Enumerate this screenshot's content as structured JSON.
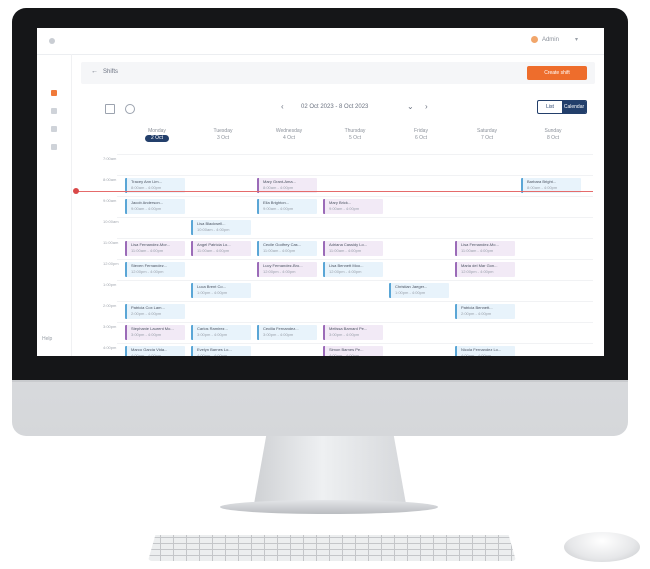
{
  "app": {
    "header_title": "Shifts",
    "create_button": "Create shift",
    "user_name": "Admin",
    "date_range": "02 Oct 2023 - 8 Oct 2023",
    "view_toggle": [
      "List",
      "Calendar"
    ],
    "sidebar_label": "Help"
  },
  "days": [
    {
      "name": "Monday",
      "date": "2 Oct"
    },
    {
      "name": "Tuesday",
      "date": "3 Oct"
    },
    {
      "name": "Wednesday",
      "date": "4 Oct"
    },
    {
      "name": "Thursday",
      "date": "5 Oct"
    },
    {
      "name": "Friday",
      "date": "6 Oct"
    },
    {
      "name": "Saturday",
      "date": "7 Oct"
    },
    {
      "name": "Sunday",
      "date": "8 Oct"
    }
  ],
  "times": [
    "7:00am",
    "8:00am",
    "9:00am",
    "10:00am",
    "11:00am",
    "12:00pm",
    "1:00pm",
    "2:00pm",
    "3:00pm",
    "4:00pm"
  ],
  "events": [
    {
      "title": "Tracey Ann Lim...",
      "sub": "8:00am - 4:00pm",
      "color": "blue"
    },
    {
      "title": "Mary Grant-Ama...",
      "sub": "8:00am - 4:00pm",
      "color": "purple"
    },
    {
      "title": "Barbara Bright...",
      "sub": "8:00am - 4:00pm",
      "color": "blue"
    },
    {
      "title": "Jacob Anderson...",
      "sub": "9:00am - 4:00pm",
      "color": "blue"
    },
    {
      "title": "Ella Brighton...",
      "sub": "9:00am - 4:00pm",
      "color": "blue"
    },
    {
      "title": "Mary Brick...",
      "sub": "9:00am - 4:00pm",
      "color": "purple"
    },
    {
      "title": "Lisa Blackwell...",
      "sub": "10:00am - 4:00pm",
      "color": "blue"
    },
    {
      "title": "Lisa Fernandez-Mor...",
      "sub": "11:00am - 4:00pm",
      "color": "purple"
    },
    {
      "title": "Angel Patricia Lo...",
      "sub": "11:00am - 4:00pm",
      "color": "purple"
    },
    {
      "title": "Cecile Godfrey Cas...",
      "sub": "11:00am - 4:00pm",
      "color": "blue"
    },
    {
      "title": "Adriana Cassidy Lo...",
      "sub": "11:00am - 4:00pm",
      "color": "purple"
    },
    {
      "title": "Lisa Fernandez-Mo...",
      "sub": "11:00am - 4:00pm",
      "color": "purple"
    },
    {
      "title": "Steven Fernandez...",
      "sub": "12:00pm - 4:00pm",
      "color": "blue"
    },
    {
      "title": "Lucy Fernandez-Bro...",
      "sub": "12:00pm - 4:00pm",
      "color": "purple"
    },
    {
      "title": "Lisa Bennett Moo...",
      "sub": "12:00pm - 4:00pm",
      "color": "blue"
    },
    {
      "title": "Maria del Mar Gon...",
      "sub": "12:00pm - 4:00pm",
      "color": "purple"
    },
    {
      "title": "Luca Brent Co...",
      "sub": "1:00pm - 4:00pm",
      "color": "blue"
    },
    {
      "title": "Christian Jaeger...",
      "sub": "1:00pm - 4:00pm",
      "color": "blue"
    },
    {
      "title": "Patricia Cox Lam...",
      "sub": "2:00pm - 4:00pm",
      "color": "blue"
    },
    {
      "title": "Patricia Bennett...",
      "sub": "2:00pm - 4:00pm",
      "color": "blue"
    },
    {
      "title": "Stephanie Laurent Mo...",
      "sub": "3:00pm - 4:00pm",
      "color": "purple"
    },
    {
      "title": "Carlos Ramirez...",
      "sub": "3:00pm - 4:00pm",
      "color": "blue"
    },
    {
      "title": "Cecilia Fernandez...",
      "sub": "3:00pm - 4:00pm",
      "color": "blue"
    },
    {
      "title": "Melissa Barnard Pe...",
      "sub": "3:00pm - 4:00pm",
      "color": "purple"
    },
    {
      "title": "Marco Garcia Vida...",
      "sub": "4:00pm - 4:00pm",
      "color": "blue"
    },
    {
      "title": "Evelyn Barnes Lo...",
      "sub": "4:00pm - 4:00pm",
      "color": "blue"
    },
    {
      "title": "Simon Barnes Pe...",
      "sub": "4:00pm - 4:00pm",
      "color": "purple"
    },
    {
      "title": "Nicola Fernandez Lo...",
      "sub": "4:00pm - 4:00pm",
      "color": "blue"
    }
  ]
}
